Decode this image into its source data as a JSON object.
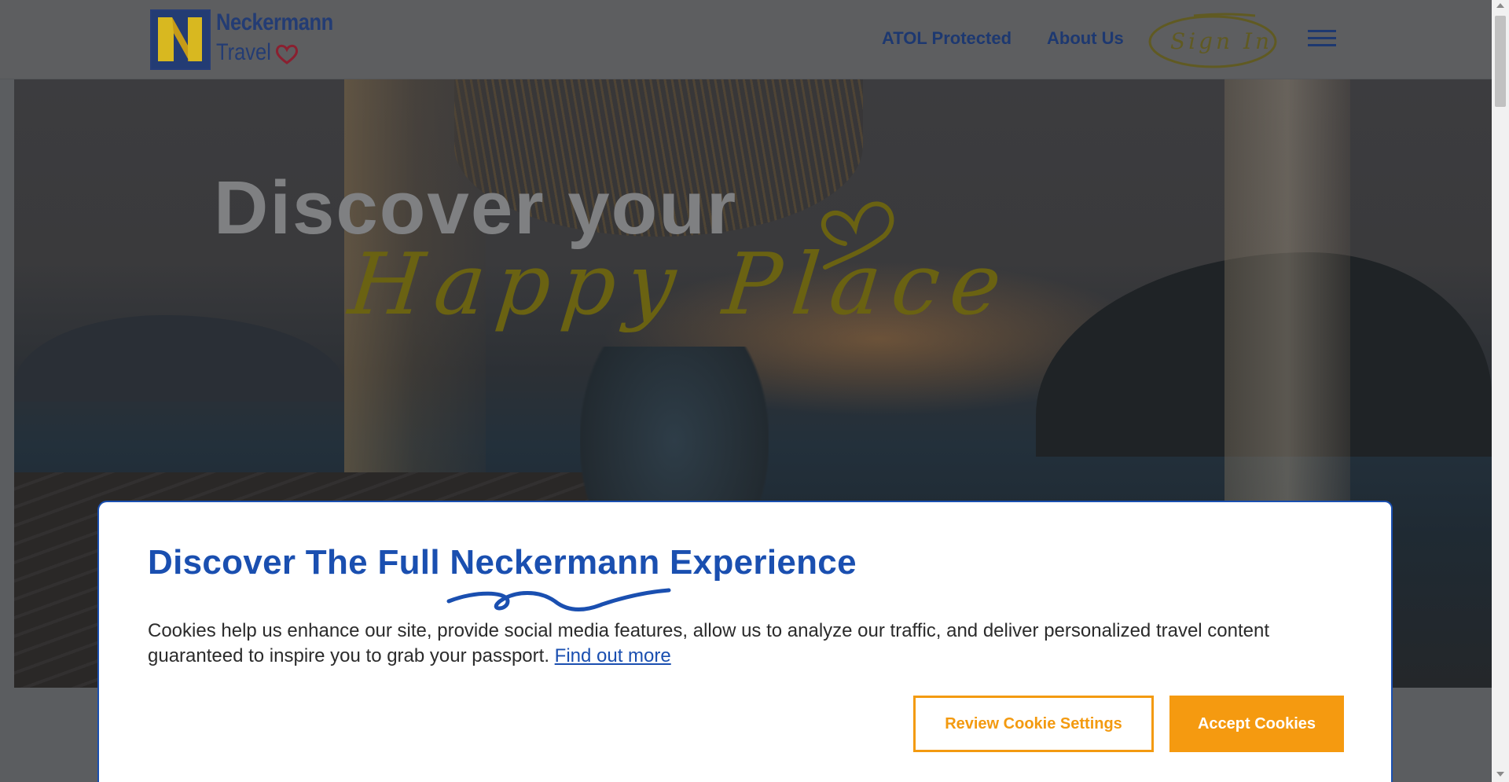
{
  "header": {
    "logo_line1": "Neckermann",
    "logo_line2": "Travel",
    "nav": [
      "ATOL Protected",
      "About Us"
    ],
    "sign_in_label": "Sign In",
    "menu_icon": "hamburger-icon"
  },
  "hero": {
    "title": "Discover your",
    "script_text": "Happy Place",
    "heart_icon": "heart-outline-icon"
  },
  "cookie_banner": {
    "title": "Discover The Full Neckermann Experience",
    "body": "Cookies help us enhance our site, provide social media features, allow us to analyze our traffic, and deliver personalized travel content guaranteed to inspire you to grab your passport.",
    "link_label": "Find out more",
    "review_label": "Review Cookie Settings",
    "accept_label": "Accept Cookies"
  },
  "colors": {
    "brand_blue": "#1a4fb0",
    "accent_orange": "#f59a10",
    "script_yellow": "#6a6212"
  }
}
